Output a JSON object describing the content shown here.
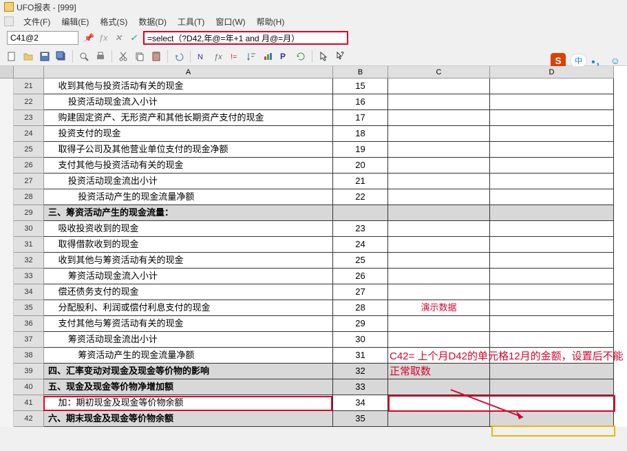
{
  "window": {
    "title": "UFO报表 - [999]"
  },
  "menu": {
    "file": "文件(F)",
    "edit": "编辑(E)",
    "format": "格式(S)",
    "data": "数据(D)",
    "tools": "工具(T)",
    "window": "窗口(W)",
    "help": "帮助(H)"
  },
  "formula_bar": {
    "cell_ref": "C41@2",
    "formula": "=select（?D42,年@=年+1 and 月@=月）"
  },
  "columns": {
    "a": "A",
    "b": "B",
    "c": "C",
    "d": "D"
  },
  "rows": [
    {
      "num": 21,
      "a": "    收到其他与投资活动有关的现金",
      "b": "15",
      "shaded": false
    },
    {
      "num": 22,
      "a": "        投资活动现金流入小计",
      "b": "16",
      "shaded": false
    },
    {
      "num": 23,
      "a": "    购建固定资产、无形资产和其他长期资产支付的现金",
      "b": "17",
      "shaded": false
    },
    {
      "num": 24,
      "a": "    投资支付的现金",
      "b": "18",
      "shaded": false
    },
    {
      "num": 25,
      "a": "    取得子公司及其他营业单位支付的现金净额",
      "b": "19",
      "shaded": false
    },
    {
      "num": 26,
      "a": "    支付其他与投资活动有关的现金",
      "b": "20",
      "shaded": false
    },
    {
      "num": 27,
      "a": "        投资活动现金流出小计",
      "b": "21",
      "shaded": false
    },
    {
      "num": 28,
      "a": "            投资活动产生的现金流量净额",
      "b": "22",
      "shaded": false
    },
    {
      "num": 29,
      "a": "三、筹资活动产生的现金流量：",
      "b": "",
      "shaded": true,
      "bold": true
    },
    {
      "num": 30,
      "a": "    吸收投资收到的现金",
      "b": "23",
      "shaded": false
    },
    {
      "num": 31,
      "a": "    取得借款收到的现金",
      "b": "24",
      "shaded": false
    },
    {
      "num": 32,
      "a": "    收到其他与筹资活动有关的现金",
      "b": "25",
      "shaded": false
    },
    {
      "num": 33,
      "a": "        筹资活动现金流入小计",
      "b": "26",
      "shaded": false
    },
    {
      "num": 34,
      "a": "    偿还债务支付的现金",
      "b": "27",
      "shaded": false
    },
    {
      "num": 35,
      "a": "    分配股利、利润或偿付利息支付的现金",
      "b": "28",
      "shaded": false,
      "demo": true
    },
    {
      "num": 36,
      "a": "    支付其他与筹资活动有关的现金",
      "b": "29",
      "shaded": false
    },
    {
      "num": 37,
      "a": "        筹资活动现金流出小计",
      "b": "30",
      "shaded": false
    },
    {
      "num": 38,
      "a": "            筹资活动产生的现金流量净额",
      "b": "31",
      "shaded": false
    },
    {
      "num": 39,
      "a": "四、汇率变动对现金及现金等价物的影响",
      "b": "32",
      "shaded": true,
      "bold": true
    },
    {
      "num": 40,
      "a": "五、现金及现金等价物净增加额",
      "b": "33",
      "shaded": true,
      "bold": true
    },
    {
      "num": 41,
      "a": "    加：期初现金及现金等价物余额",
      "b": "34",
      "shaded": false
    },
    {
      "num": 42,
      "a": "六、期末现金及现金等价物余额",
      "b": "35",
      "shaded": true,
      "bold": true
    }
  ],
  "demo_label": "演示数据",
  "annotation": "C42= 上个月D42的单元格12月的金额，设置后不能正常取数",
  "ime": {
    "s": "S",
    "zw": "中"
  }
}
